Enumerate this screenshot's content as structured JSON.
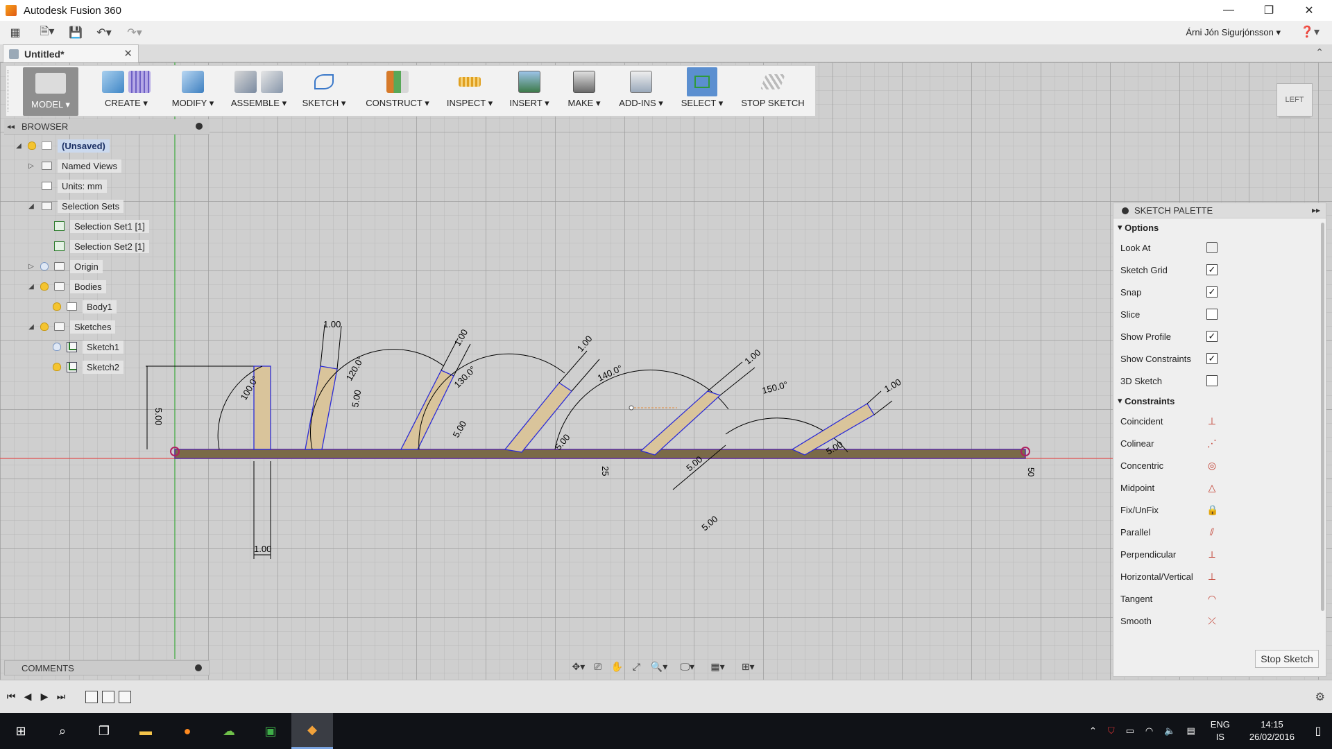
{
  "app": {
    "title": "Autodesk Fusion 360",
    "user": "Árni Jón Sigurjónsson",
    "help_icon": "help-icon"
  },
  "document_tab": {
    "label": "Untitled*",
    "close": "✕"
  },
  "toolbar": {
    "model_label": "MODEL",
    "create_label": "CREATE",
    "modify_label": "MODIFY",
    "assemble_label": "ASSEMBLE",
    "sketch_label": "SKETCH",
    "construct_label": "CONSTRUCT",
    "inspect_label": "INSPECT",
    "insert_label": "INSERT",
    "make_label": "MAKE",
    "addins_label": "ADD-INS",
    "select_label": "SELECT",
    "stop_sketch_label": "STOP SKETCH"
  },
  "browser": {
    "title": "BROWSER",
    "items": [
      {
        "label": "(Unsaved)"
      },
      {
        "label": "Named Views"
      },
      {
        "label": "Units: mm"
      },
      {
        "label": "Selection Sets"
      },
      {
        "label": "Selection Set1 [1]"
      },
      {
        "label": "Selection Set2 [1]"
      },
      {
        "label": "Origin"
      },
      {
        "label": "Bodies"
      },
      {
        "label": "Body1"
      },
      {
        "label": "Sketches"
      },
      {
        "label": "Sketch1"
      },
      {
        "label": "Sketch2"
      }
    ]
  },
  "comments": {
    "title": "COMMENTS"
  },
  "viewcube": {
    "label": "LEFT"
  },
  "palette": {
    "title": "SKETCH PALETTE",
    "options_label": "Options",
    "options": [
      {
        "label": "Look At",
        "checked": null
      },
      {
        "label": "Sketch Grid",
        "checked": true
      },
      {
        "label": "Snap",
        "checked": true
      },
      {
        "label": "Slice",
        "checked": false
      },
      {
        "label": "Show Profile",
        "checked": true
      },
      {
        "label": "Show Constraints",
        "checked": true
      },
      {
        "label": "3D Sketch",
        "checked": false
      }
    ],
    "constraints_label": "Constraints",
    "constraints": [
      {
        "label": "Coincident",
        "icon": "coincident-icon"
      },
      {
        "label": "Colinear",
        "icon": "colinear-icon"
      },
      {
        "label": "Concentric",
        "icon": "concentric-icon"
      },
      {
        "label": "Midpoint",
        "icon": "midpoint-icon"
      },
      {
        "label": "Fix/UnFix",
        "icon": "fix-icon"
      },
      {
        "label": "Parallel",
        "icon": "parallel-icon"
      },
      {
        "label": "Perpendicular",
        "icon": "perpendicular-icon"
      },
      {
        "label": "Horizontal/Vertical",
        "icon": "horizontal-vertical-icon"
      },
      {
        "label": "Tangent",
        "icon": "tangent-icon"
      },
      {
        "label": "Smooth",
        "icon": "smooth-icon"
      }
    ],
    "stop_button": "Stop Sketch"
  },
  "sketch": {
    "dim_5": "5.00",
    "dim_1": "1.00",
    "angle_100": "100.0°",
    "angle_120": "120.0°",
    "angle_130": "130.0°",
    "angle_140": "140.0°",
    "angle_150": "150.0°",
    "label_25": "25",
    "label_50": "50"
  },
  "taskbar": {
    "lang_1": "ENG",
    "lang_2": "IS",
    "time": "14:15",
    "date": "26/02/2016"
  },
  "colors": {
    "accent": "#5b8fd0",
    "sketch_fill": "#d9c49b",
    "sketch_line": "#2b2bd6",
    "base_bar": "#7a6a48",
    "axis_red": "#e05050",
    "axis_green": "#3caa3c"
  }
}
